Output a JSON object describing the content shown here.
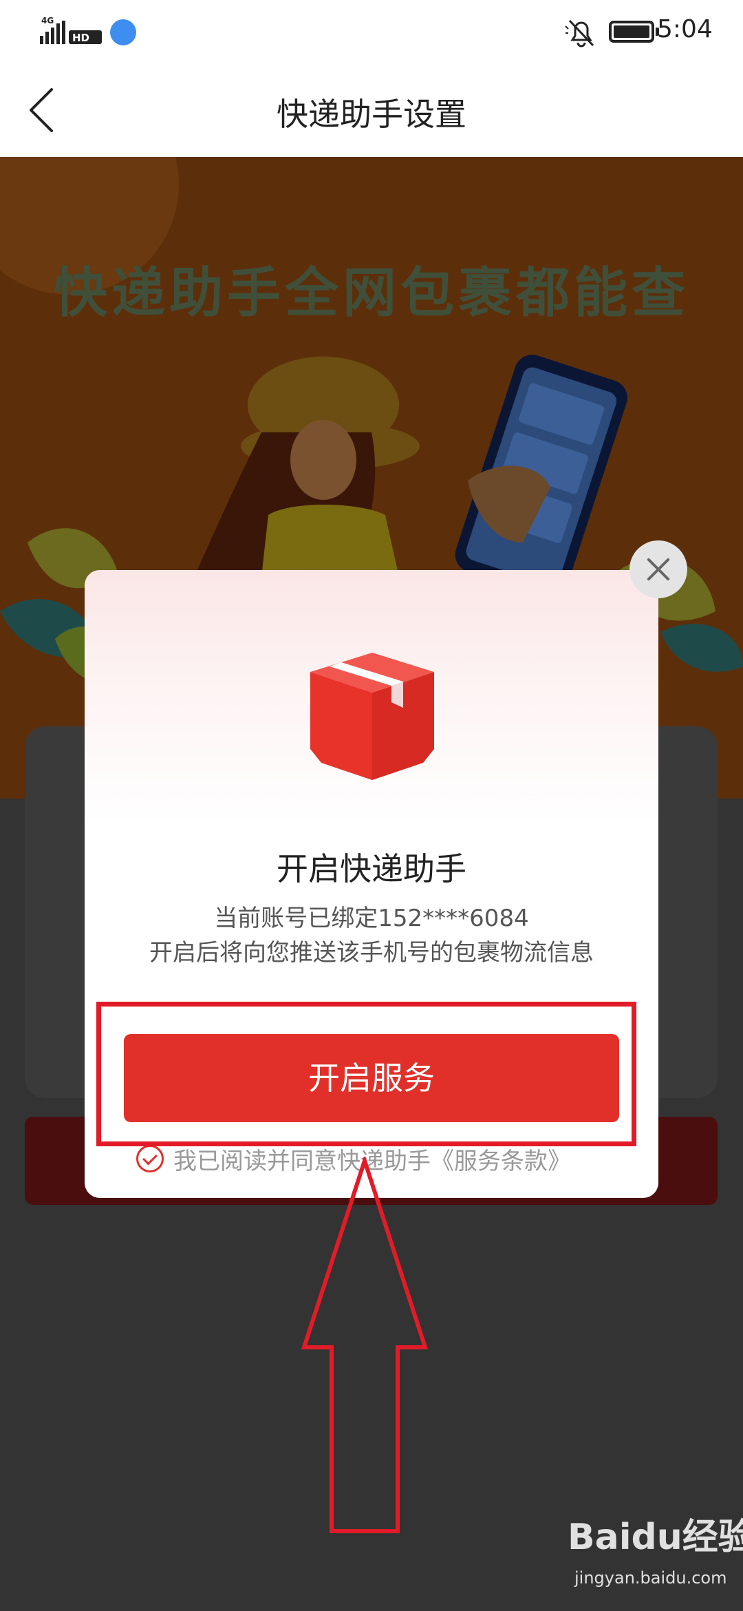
{
  "status_bar": {
    "network": "4G",
    "hd_label": "HD",
    "time": "5:04"
  },
  "header": {
    "title": "快递助手设置",
    "back_icon": "chevron-left-icon"
  },
  "background": {
    "headline": "快递助手全网包裹都能查"
  },
  "modal": {
    "icon": "package-icon",
    "title": "开启快递助手",
    "desc_line1": "当前账号已绑定152****6084",
    "desc_line2": "开启后将向您推送该手机号的包裹物流信息",
    "primary_button": "开启服务",
    "agreement_text": "我已阅读并同意快递助手《服务条款》",
    "close_icon": "close-icon"
  },
  "watermark": {
    "logo": "Baidu经验",
    "url": "jingyan.baidu.com"
  },
  "colors": {
    "accent": "#e1302a",
    "annotation": "#e21b28",
    "overlay": "#333333"
  }
}
